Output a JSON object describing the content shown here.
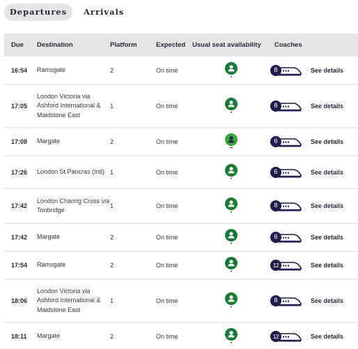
{
  "tabs": [
    {
      "label": "Departures",
      "active": true
    },
    {
      "label": "Arrivals",
      "active": false
    }
  ],
  "table": {
    "headers": {
      "due": "Due",
      "destination": "Destination",
      "platform": "Platform",
      "expected": "Expected",
      "seat": "Usual seat availability",
      "coaches": "Coaches"
    },
    "rows": [
      {
        "due": "16:54",
        "destination": "Ramsgate",
        "platform": "2",
        "expected": "On time",
        "seat_level": 1,
        "seat_icon": "person-icon",
        "coaches": "8",
        "details": "See details"
      },
      {
        "due": "17:05",
        "destination": "London Victoria via Ashford International & Maidstone East",
        "platform": "1",
        "expected": "On time",
        "seat_level": 1,
        "seat_icon": "person-icon",
        "coaches": "8",
        "details": "See details"
      },
      {
        "due": "17:08",
        "destination": "Margate",
        "platform": "2",
        "expected": "On time",
        "seat_level": 2,
        "seat_icon": "person-icon",
        "coaches": "6",
        "details": "See details"
      },
      {
        "due": "17:26",
        "destination": "London St Pancras (Intl)",
        "platform": "1",
        "expected": "On time",
        "seat_level": 1,
        "seat_icon": "person-icon",
        "coaches": "6",
        "details": "See details"
      },
      {
        "due": "17:42",
        "destination": "London Charing Cross via Tonbridge",
        "platform": "1",
        "expected": "On time",
        "seat_level": 1,
        "seat_icon": "person-icon",
        "coaches": "8",
        "details": "See details"
      },
      {
        "due": "17:42",
        "destination": "Margate",
        "platform": "2",
        "expected": "On time",
        "seat_level": 1,
        "seat_icon": "person-icon",
        "coaches": "6",
        "details": "See details"
      },
      {
        "due": "17:54",
        "destination": "Ramsgate",
        "platform": "2",
        "expected": "On time",
        "seat_level": 1,
        "seat_icon": "person-icon",
        "coaches": "12",
        "details": "See details"
      },
      {
        "due": "18:06",
        "destination": "London Victoria via Ashford International & Maidstone East",
        "platform": "1",
        "expected": "On time",
        "seat_level": 1,
        "seat_icon": "person-icon",
        "coaches": "8",
        "details": "See details"
      },
      {
        "due": "18:11",
        "destination": "Margate",
        "platform": "2",
        "expected": "On time",
        "seat_level": 1,
        "seat_icon": "person-icon",
        "coaches": "12",
        "details": "See details"
      }
    ]
  },
  "colors": {
    "seat_level_1": "#1b7a3a",
    "seat_level_2": "#3aa63f",
    "seat_person": "#ffffff",
    "seat_person_level_2": "#1c2a4a",
    "coach_badge": "#1e1c4a"
  }
}
